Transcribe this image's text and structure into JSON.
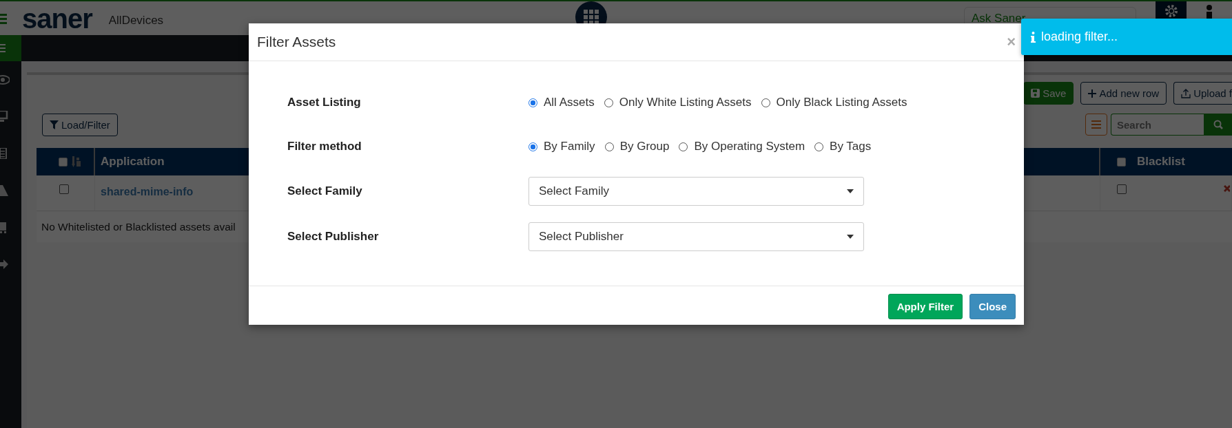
{
  "header": {
    "logo": "saner",
    "context": "AllDevices",
    "ask_placeholder": "Ask Saner"
  },
  "toolbar": {
    "buttons": [
      {
        "label": "Save",
        "kind": "save"
      },
      {
        "label": "Add new row",
        "kind": "add"
      },
      {
        "label": "Upload f",
        "kind": "upload"
      }
    ],
    "filter_button": "Load/Filter",
    "search_placeholder": "Search"
  },
  "table": {
    "columns": [
      "Application",
      "Blacklist"
    ],
    "all_checked": false,
    "all_blacklisted": false,
    "rows": [
      {
        "application": "shared-mime-info",
        "checked": false,
        "blacklisted": false
      }
    ],
    "empty_message": "No Whitelisted or Blacklisted assets avail"
  },
  "modal": {
    "title": "Filter Assets",
    "close_glyph": "×",
    "fields": [
      {
        "label": "Asset Listing",
        "kind": "radio",
        "options": [
          {
            "label": "All Assets",
            "selected": true
          },
          {
            "label": "Only White Listing Assets",
            "selected": false
          },
          {
            "label": "Only Black Listing Assets",
            "selected": false
          }
        ]
      },
      {
        "label": "Filter method",
        "kind": "radio",
        "options": [
          {
            "label": "By Family",
            "selected": true
          },
          {
            "label": "By Group",
            "selected": false
          },
          {
            "label": "By Operating System",
            "selected": false
          },
          {
            "label": "By Tags",
            "selected": false
          }
        ]
      },
      {
        "label": "Select Family",
        "kind": "select",
        "placeholder": "Select Family"
      },
      {
        "label": "Select Publisher",
        "kind": "select",
        "placeholder": "Select Publisher"
      }
    ],
    "buttons": [
      {
        "label": "Apply Filter",
        "kind": "primary"
      },
      {
        "label": "Close",
        "kind": "secondary"
      }
    ]
  },
  "toast": {
    "message": "loading filter..."
  }
}
